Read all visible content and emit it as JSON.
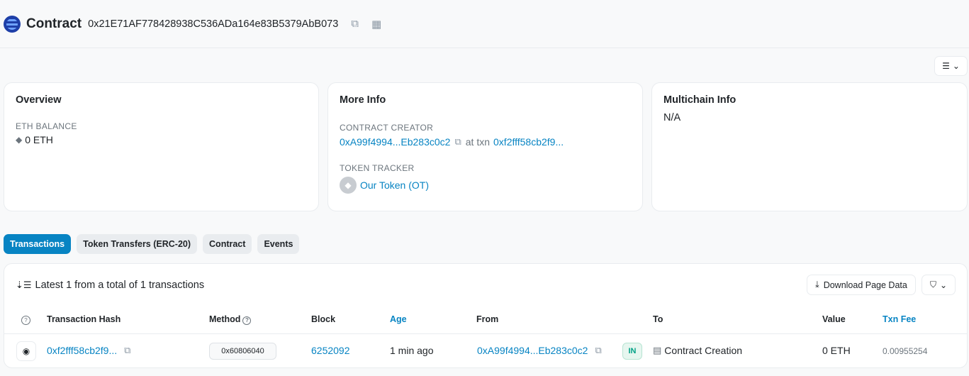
{
  "header": {
    "title": "Contract",
    "address": "0x21E71AF778428938C536ADa164e83B5379AbB073",
    "copy_icon": "copy-icon",
    "qr_icon": "qr-code-icon"
  },
  "overview": {
    "title": "Overview",
    "balance_label": "ETH BALANCE",
    "balance_value": "0 ETH"
  },
  "more_info": {
    "title": "More Info",
    "creator_label": "CONTRACT CREATOR",
    "creator_address": "0xA99f4994...Eb283c0c2",
    "at_txn": "at txn",
    "creator_txn": "0xf2fff58cb2f9...",
    "token_label": "TOKEN TRACKER",
    "token_name": "Our Token (OT)"
  },
  "multichain": {
    "title": "Multichain Info",
    "value": "N/A"
  },
  "tabs": [
    {
      "label": "Transactions",
      "active": true
    },
    {
      "label": "Token Transfers (ERC-20)",
      "active": false
    },
    {
      "label": "Contract",
      "active": false
    },
    {
      "label": "Events",
      "active": false
    }
  ],
  "transactions": {
    "summary": "Latest 1 from a total of 1 transactions",
    "download_label": "Download Page Data",
    "columns": [
      "Transaction Hash",
      "Method",
      "Block",
      "Age",
      "From",
      "To",
      "Value",
      "Txn Fee"
    ],
    "rows": [
      {
        "hash": "0xf2fff58cb2f9...",
        "method": "0x60806040",
        "block": "6252092",
        "age": "1 min ago",
        "from": "0xA99f4994...Eb283c0c2",
        "direction": "IN",
        "to": "Contract Creation",
        "value": "0 ETH",
        "fee": "0.00955254"
      }
    ]
  }
}
